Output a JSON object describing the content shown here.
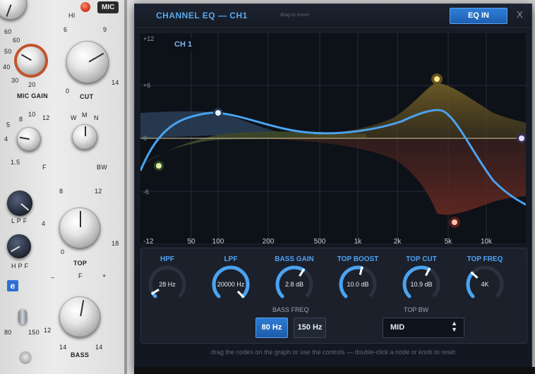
{
  "console": {
    "mic_label": "MIC",
    "hi_label": "HI",
    "mic_gain_label": "MIC GAIN",
    "cut_label": "CUT",
    "f_label": "F",
    "bw_label": "BW",
    "w_label": "W",
    "m_label": "M",
    "n_label": "N",
    "lpf_label": "L P F",
    "hpf_label": "H P F",
    "top_label": "TOP",
    "bass_label": "BASS",
    "e_label": "e",
    "mic_gain_scale": [
      "60",
      "50",
      "40",
      "30",
      "20"
    ],
    "mic_gain_top": "60",
    "f_scale": [
      "5",
      "8",
      "10",
      "12",
      "4",
      "1.5"
    ],
    "cut_scale": [
      "6",
      "9",
      "0",
      "14"
    ],
    "top_scale": [
      "8",
      "12",
      "4",
      "18",
      "0"
    ],
    "bass_scale": [
      "F",
      "12",
      "14",
      "14"
    ],
    "bass_signs": [
      "–",
      "+"
    ],
    "switch_labels": [
      "80",
      "150"
    ]
  },
  "window": {
    "title": "CHANNEL EQ — CH1",
    "drag_hint": "drag to move",
    "eq_in_label": "EQ IN",
    "close_label": "X"
  },
  "graph": {
    "channel_label": "CH 1",
    "y_labels": [
      "+12",
      "+6",
      "0",
      "-6",
      "-12"
    ],
    "x_labels": [
      "50",
      "100",
      "200",
      "500",
      "1k",
      "2k",
      "5k",
      "10k"
    ],
    "colors": {
      "grid": "#262c38",
      "curve": "#4aa3f0",
      "bass_fill": "#3e4a2a",
      "boost_fill": "#6b5a24",
      "cut_fill": "#5a2a22",
      "hpf_fill": "#2c3f58"
    }
  },
  "controls": {
    "hpf": {
      "label": "HPF",
      "value": "28 Hz",
      "level": 0.05
    },
    "lpf": {
      "label": "LPF",
      "value": "20000 Hz",
      "level": 1.0
    },
    "bass_gain": {
      "label": "BASS GAIN",
      "value": "2.8 dB",
      "level": 0.62
    },
    "top_boost": {
      "label": "TOP BOOST",
      "value": "10.0 dB",
      "level": 0.55
    },
    "top_cut": {
      "label": "TOP CUT",
      "value": "10.9 dB",
      "level": 0.6
    },
    "top_freq": {
      "label": "TOP FREQ",
      "value": "4K",
      "level": 0.32
    },
    "bass_freq": {
      "label": "BASS FREQ",
      "options": [
        "80 Hz",
        "150 Hz"
      ],
      "selected": "80 Hz"
    },
    "top_bw": {
      "label": "TOP BW",
      "value": "MID"
    },
    "accent": "#4aa3f0",
    "track": "#2b3140"
  },
  "footer_hint": "drag the nodes on the graph or use the controls — double-click a node or knob to reset"
}
